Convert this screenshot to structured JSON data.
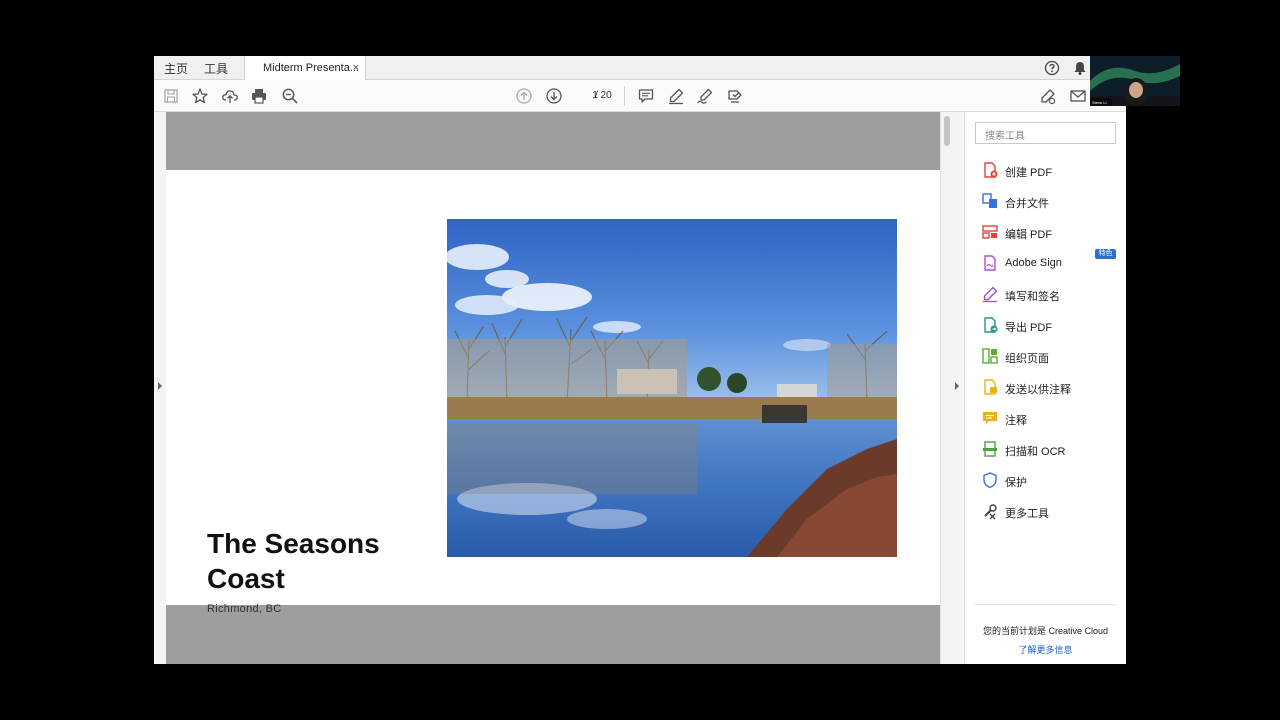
{
  "tabs": {
    "home": "主页",
    "tools": "工具",
    "document": "Midterm Presenta...",
    "close": "×"
  },
  "page_nav": {
    "current": "1",
    "total": "/ 20"
  },
  "slide": {
    "title_line1": "The Seasons",
    "title_line2": "Coast",
    "subtitle": "Richmond,  BC"
  },
  "panel": {
    "search_placeholder": "搜索工具",
    "tools": [
      {
        "label": "创建 PDF",
        "icon": "create-pdf-icon",
        "color": "#e0423a"
      },
      {
        "label": "合并文件",
        "icon": "combine-files-icon",
        "color": "#3a6fd8"
      },
      {
        "label": "编辑 PDF",
        "icon": "edit-pdf-icon",
        "color": "#e0423a"
      },
      {
        "label": "Adobe Sign",
        "icon": "adobe-sign-icon",
        "color": "#b34fcf"
      },
      {
        "label": "填写和签名",
        "icon": "fill-sign-icon",
        "color": "#9b50d8"
      },
      {
        "label": "导出 PDF",
        "icon": "export-pdf-icon",
        "color": "#1d9a8c"
      },
      {
        "label": "组织页面",
        "icon": "organize-pages-icon",
        "color": "#5cae2f"
      },
      {
        "label": "发送以供注释",
        "icon": "send-comment-icon",
        "color": "#e8b31a"
      },
      {
        "label": "注释",
        "icon": "comment-icon",
        "color": "#e8b31a"
      },
      {
        "label": "扫描和 OCR",
        "icon": "scan-ocr-icon",
        "color": "#4aa23a"
      },
      {
        "label": "保护",
        "icon": "protect-icon",
        "color": "#3a6fd8"
      },
      {
        "label": "更多工具",
        "icon": "more-tools-icon",
        "color": "#444444"
      }
    ],
    "badge": "特色",
    "plan_text": "您的当前计划是 Creative Cloud",
    "learn_more": "了解更多信息"
  },
  "webcam": {
    "name": "Steve Li"
  },
  "colors": {
    "accent": "#2d6dd2",
    "doc_bg": "#9e9e9e"
  }
}
